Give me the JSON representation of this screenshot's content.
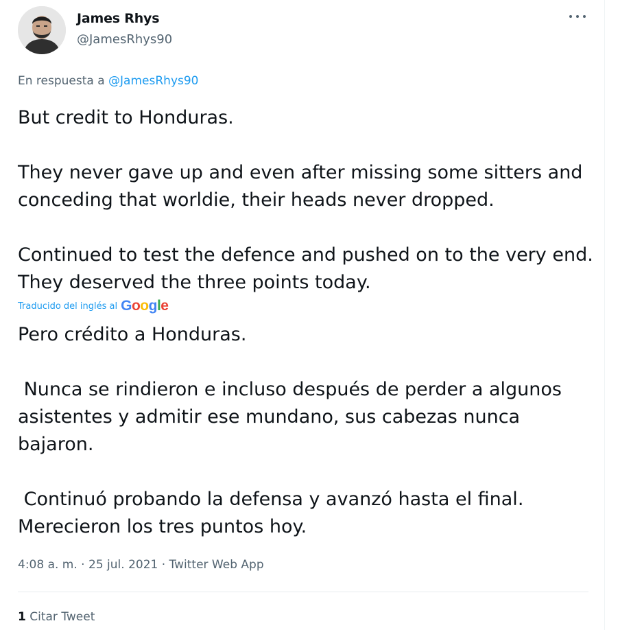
{
  "author": {
    "name": "James Rhys",
    "handle": "@JamesRhys90"
  },
  "reply": {
    "prefix": "En respuesta a",
    "handle": "@JamesRhys90"
  },
  "tweet": {
    "text": "But credit to Honduras.\n\nThey never gave up and even after missing some sitters and conceding that worldie, their heads never dropped.\n\nContinued to test the defence and pushed on to the very end. They deserved the three points today."
  },
  "translation": {
    "label": "Traducido del inglés al",
    "provider": "Google",
    "text": "Pero crédito a Honduras.\n\n Nunca se rindieron e incluso después de perder a algunos asistentes y admitir ese mundano, sus cabezas nunca bajaron.\n\n Continuó probando la defensa y avanzó hasta el final. Merecieron los tres puntos hoy."
  },
  "meta": {
    "time": "4:08 a. m.",
    "separator1": " · ",
    "date": "25 jul. 2021",
    "separator2": " · ",
    "app": "Twitter Web App"
  },
  "stats": {
    "quote_count": "1",
    "quote_label": "Citar Tweet"
  },
  "colors": {
    "link": "#1d9bf0",
    "secondary_text": "#536471"
  }
}
